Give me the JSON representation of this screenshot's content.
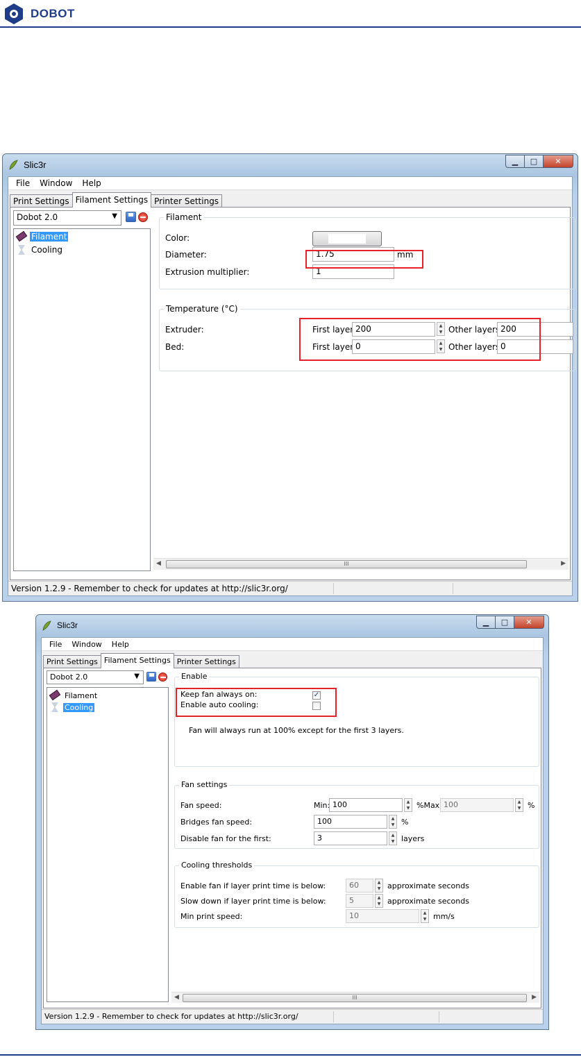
{
  "doc": {
    "brand": "DOBOT"
  },
  "window1": {
    "title": "Slic3r",
    "menu": [
      "File",
      "Window",
      "Help"
    ],
    "tabs": [
      "Print Settings",
      "Filament Settings",
      "Printer Settings"
    ],
    "preset": "Dobot 2.0",
    "tree": [
      "Filament",
      "Cooling"
    ],
    "filament": {
      "legend": "Filament",
      "color_label": "Color:",
      "diameter_label": "Diameter:",
      "diameter_value": "1.75",
      "diameter_unit": "mm",
      "extrusion_label": "Extrusion multiplier:",
      "extrusion_value": "1"
    },
    "temperature": {
      "legend": "Temperature (°C)",
      "extruder_label": "Extruder:",
      "bed_label": "Bed:",
      "first_layer_label": "First layer:",
      "other_layers_label": "Other layers:",
      "extruder_first": "200",
      "extruder_other": "200",
      "bed_first": "0",
      "bed_other": "0"
    },
    "status": "Version 1.2.9 - Remember to check for updates at http://slic3r.org/"
  },
  "window2": {
    "title": "Slic3r",
    "menu": [
      "File",
      "Window",
      "Help"
    ],
    "tabs": [
      "Print Settings",
      "Filament Settings",
      "Printer Settings"
    ],
    "preset": "Dobot 2.0",
    "tree": [
      "Filament",
      "Cooling"
    ],
    "enable": {
      "legend": "Enable",
      "keep_fan_label": "Keep fan always on:",
      "keep_fan_checked": true,
      "auto_cooling_label": "Enable auto cooling:",
      "auto_cooling_checked": false,
      "note": "Fan will always run at 100% except for the first 3 layers."
    },
    "fan": {
      "legend": "Fan settings",
      "fan_speed_label": "Fan speed:",
      "min_label": "Min:",
      "min_value": "100",
      "max_label": "%Max:",
      "max_value": "100",
      "pct": "%",
      "bridges_label": "Bridges fan speed:",
      "bridges_value": "100",
      "disable_label": "Disable fan for the first:",
      "disable_value": "3",
      "layers": "layers"
    },
    "thresholds": {
      "legend": "Cooling thresholds",
      "enable_fan_label": "Enable fan if layer print time is below:",
      "enable_fan_value": "60",
      "slow_label": "Slow down if layer print time is below:",
      "slow_value": "5",
      "approx": "approximate seconds",
      "min_speed_label": "Min print speed:",
      "min_speed_value": "10",
      "mms": "mm/s"
    },
    "status": "Version 1.2.9 - Remember to check for updates at http://slic3r.org/"
  },
  "colors": {
    "highlight": "#e8202a",
    "brand": "#1f3c88",
    "selection": "#3399ff"
  }
}
